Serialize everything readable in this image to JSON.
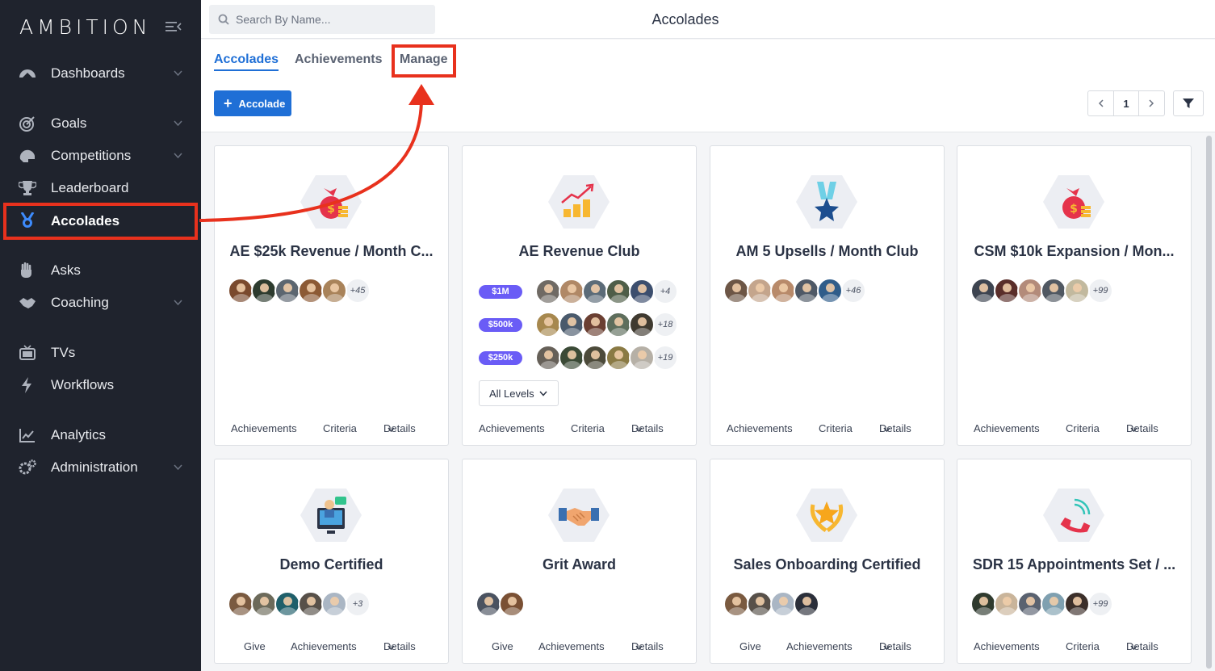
{
  "app": {
    "logo_text": "AMBITION"
  },
  "sidebar": {
    "items": [
      {
        "label": "Dashboards",
        "icon": "gauge-icon",
        "chevron": true
      },
      {
        "label": "Goals",
        "icon": "target-icon",
        "chevron": true
      },
      {
        "label": "Competitions",
        "icon": "helmet-icon",
        "chevron": true
      },
      {
        "label": "Leaderboard",
        "icon": "trophy-icon",
        "chevron": false
      },
      {
        "label": "Accolades",
        "icon": "medal-icon",
        "chevron": false,
        "active": true
      },
      {
        "label": "Asks",
        "icon": "hand-icon",
        "chevron": false
      },
      {
        "label": "Coaching",
        "icon": "handshake-icon",
        "chevron": true
      },
      {
        "label": "TVs",
        "icon": "tv-icon",
        "chevron": false
      },
      {
        "label": "Workflows",
        "icon": "bolt-icon",
        "chevron": false
      },
      {
        "label": "Analytics",
        "icon": "line-chart-icon",
        "chevron": false
      },
      {
        "label": "Administration",
        "icon": "gears-icon",
        "chevron": true
      }
    ]
  },
  "topbar": {
    "search_placeholder": "Search By Name...",
    "title": "Accolades"
  },
  "tabs": [
    {
      "label": "Accolades",
      "active": true
    },
    {
      "label": "Achievements",
      "active": false
    },
    {
      "label": "Manage",
      "active": false,
      "highlighted": true
    }
  ],
  "toolbar": {
    "add_label": "Accolade",
    "page": "1"
  },
  "cards": [
    {
      "title": "AE $25k Revenue / Month C...",
      "icon": "money-bag-icon",
      "more": "+45",
      "footer": [
        "Achievements",
        "Criteria",
        "Details"
      ]
    },
    {
      "title": "AE Revenue Club",
      "icon": "growth-chart-icon",
      "levels": [
        {
          "badge": "$1M",
          "more": "+4"
        },
        {
          "badge": "$500k",
          "more": "+18"
        },
        {
          "badge": "$250k",
          "more": "+19"
        }
      ],
      "levels_select": "All Levels",
      "footer": [
        "Achievements",
        "Criteria",
        "Details"
      ]
    },
    {
      "title": "AM 5 Upsells / Month Club",
      "icon": "star-medal-icon",
      "more": "+46",
      "footer": [
        "Achievements",
        "Criteria",
        "Details"
      ]
    },
    {
      "title": "CSM $10k Expansion / Mon...",
      "icon": "money-bag-icon",
      "more": "+99",
      "footer": [
        "Achievements",
        "Criteria",
        "Details"
      ]
    },
    {
      "title": "Demo Certified",
      "icon": "presenter-icon",
      "more": "+3",
      "footer": [
        "Give",
        "Achievements",
        "Details"
      ]
    },
    {
      "title": "Grit Award",
      "icon": "handshake-icon",
      "more": "",
      "footer": [
        "Give",
        "Achievements",
        "Details"
      ]
    },
    {
      "title": "Sales Onboarding Certified",
      "icon": "laurel-star-icon",
      "more": "",
      "footer": [
        "Give",
        "Achievements",
        "Details"
      ]
    },
    {
      "title": "SDR 15 Appointments Set / ...",
      "icon": "phone-ringing-icon",
      "more": "+99",
      "footer": [
        "Achievements",
        "Criteria",
        "Details"
      ]
    }
  ],
  "colors": {
    "sidebar_bg": "#1f232d",
    "accent": "#1f6fd6",
    "level_badge": "#6a5cf6",
    "annotation": "#e8311d"
  }
}
